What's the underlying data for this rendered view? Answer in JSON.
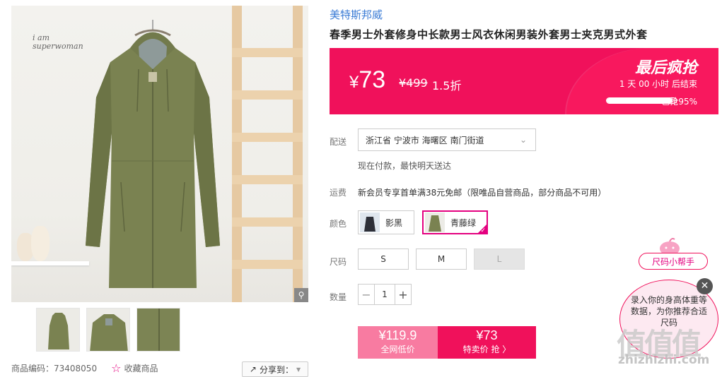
{
  "gallery": {
    "wall_text": [
      "i am",
      "superwoman"
    ],
    "zoom_icon": "magnifier-icon",
    "thumbnails": [
      "thumb-front",
      "thumb-detail",
      "thumb-fabric"
    ]
  },
  "meta": {
    "product_code": "商品编码：73408050",
    "favorite_label": "收藏商品",
    "share_label": "分享到：",
    "share_icon": "share-icon"
  },
  "product": {
    "brand": "美特斯邦威",
    "title": "春季男士外套修身中长款男士风衣休闲男装外套男士夹克男式外套"
  },
  "promo": {
    "currency": "¥",
    "price": "73",
    "old_price": "¥499",
    "discount": "1.5折",
    "flash_title": "最后疯抢",
    "countdown": "1  天  00  小时  后结束",
    "sold_percent": 0.95,
    "sold_label": "已抢95%",
    "accent_color": "#f0115b"
  },
  "delivery": {
    "label": "配送",
    "address": "浙江省 宁波市 海曙区 南门街道",
    "note": "现在付款，最快明天送达"
  },
  "shipping": {
    "label": "运费",
    "text": "新会员专享首单满38元免邮（限唯品自营商品，部分商品不可用）"
  },
  "color": {
    "label": "颜色",
    "options": [
      {
        "name": "影黑",
        "selected": false
      },
      {
        "name": "青藤绿",
        "selected": true
      }
    ]
  },
  "size": {
    "label": "尺码",
    "options": [
      {
        "name": "S",
        "disabled": false
      },
      {
        "name": "M",
        "disabled": false
      },
      {
        "name": "L",
        "disabled": true
      }
    ]
  },
  "quantity": {
    "label": "数量",
    "minus": "−",
    "value": "1",
    "plus": "+"
  },
  "buy": {
    "orig_price": "¥119.9",
    "orig_label": "全网低价",
    "flash_price": "¥73",
    "flash_label": "特卖价 抢 〉"
  },
  "size_helper": {
    "button_label": "尺码小帮手",
    "bubble_text": "录入你的身高体重等数据，为你推荐合适尺码",
    "close": "✕"
  },
  "watermark": {
    "logo": "值值值",
    "url": "zhizhizhi.com"
  }
}
